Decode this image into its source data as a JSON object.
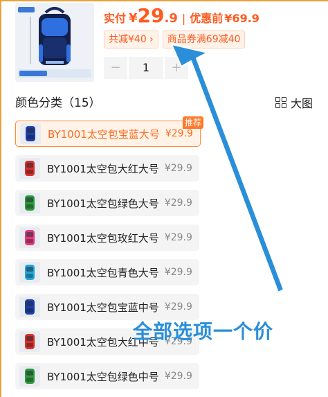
{
  "product": {
    "price_prefix": "实付",
    "price_currency": "¥",
    "price_int": "29",
    "price_dec": ".9",
    "separator": "|",
    "orig_label": "优惠前",
    "orig_price": "¥69.9",
    "discount_tag": "共减¥40 ›",
    "coupon_tag": "商品券满69减40"
  },
  "stepper": {
    "minus": "−",
    "value": "1",
    "plus": "+"
  },
  "section": {
    "title": "颜色分类（15）",
    "view_label": "大图"
  },
  "badge": {
    "recommend": "推荐"
  },
  "variants": [
    {
      "name": "BY1001太空包宝蓝大号",
      "price": "¥29.9",
      "color": "#1e3fa8",
      "selected": true
    },
    {
      "name": "BY1001太空包大红大号",
      "price": "¥29.9",
      "color": "#d8302c",
      "selected": false
    },
    {
      "name": "BY1001太空包绿色大号",
      "price": "¥29.9",
      "color": "#2e9a3c",
      "selected": false
    },
    {
      "name": "BY1001太空包玫红大号",
      "price": "¥29.9",
      "color": "#e03a7a",
      "selected": false
    },
    {
      "name": "BY1001太空包青色大号",
      "price": "¥29.9",
      "color": "#22a8d8",
      "selected": false
    },
    {
      "name": "BY1001太空包宝蓝中号",
      "price": "¥29.9",
      "color": "#1e3fa8",
      "selected": false
    },
    {
      "name": "BY1001太空包大红中号",
      "price": "¥29.9",
      "color": "#d8302c",
      "selected": false
    },
    {
      "name": "BY1001太空包绿色中号",
      "price": "¥29.9",
      "color": "#2e9a3c",
      "selected": false
    }
  ],
  "annotation": {
    "text": "全部选项一个价",
    "color": "#2a8fd8"
  },
  "colors": {
    "accent": "#ff5a1f",
    "frame": "#e9a23b"
  }
}
